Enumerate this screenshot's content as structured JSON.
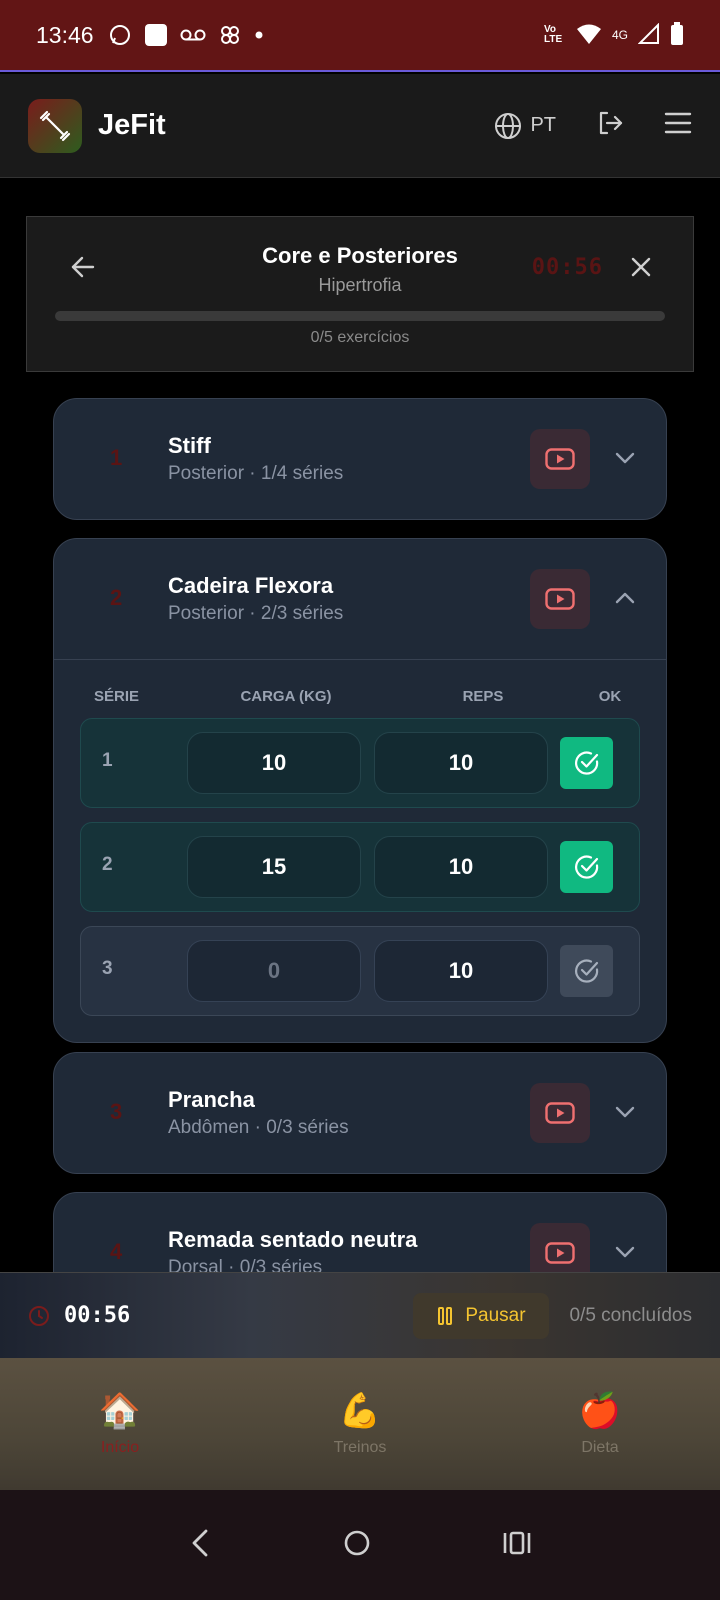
{
  "status_bar": {
    "time": "13:46",
    "network": "4G",
    "volte": "Vo LTE"
  },
  "app": {
    "name": "JeFit",
    "language": "PT"
  },
  "workout": {
    "title": "Core e Posteriores",
    "subtitle": "Hipertrofia",
    "timer": "00:56",
    "progress_fraction": 0,
    "progress_text": "0/5 exercícios"
  },
  "exercises": [
    {
      "number": "1",
      "name": "Stiff",
      "meta": "Posterior · 1/4 séries",
      "expanded": false
    },
    {
      "number": "2",
      "name": "Cadeira Flexora",
      "meta": "Posterior · 2/3 séries",
      "expanded": true
    },
    {
      "number": "3",
      "name": "Prancha",
      "meta": "Abdômen · 0/3 séries",
      "expanded": false
    },
    {
      "number": "4",
      "name": "Remada sentado neutra",
      "meta": "Dorsal · 0/3 séries",
      "expanded": false
    }
  ],
  "sets_table": {
    "headers": {
      "serie": "SÉRIE",
      "carga": "CARGA (KG)",
      "reps": "REPS",
      "ok": "OK"
    },
    "rows": [
      {
        "serie": "1",
        "carga": "10",
        "reps": "10",
        "done": true
      },
      {
        "serie": "2",
        "carga": "15",
        "reps": "10",
        "done": true
      },
      {
        "serie": "3",
        "carga": "0",
        "reps": "10",
        "done": false
      }
    ]
  },
  "bottom_bar": {
    "timer": "00:56",
    "pause_label": "Pausar",
    "completed": "0/5 concluídos"
  },
  "nav": [
    {
      "label": "Início",
      "emoji": "🏠",
      "active": true
    },
    {
      "label": "Treinos",
      "emoji": "💪",
      "active": false
    },
    {
      "label": "Dieta",
      "emoji": "🍎",
      "active": false
    }
  ],
  "colors": {
    "accent": "#7a1c1c",
    "success": "#10b981",
    "pause": "#f4c430",
    "card": "#1f2937"
  }
}
